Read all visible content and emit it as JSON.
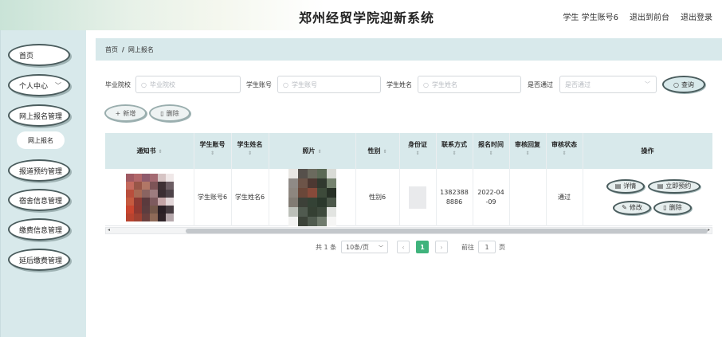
{
  "header": {
    "title": "郑州经贸学院迎新系统",
    "user_role": "学生",
    "user_name": "学生账号6",
    "back_label": "退出到前台",
    "logout_label": "退出登录"
  },
  "sidebar": {
    "items": [
      {
        "label": "首页"
      },
      {
        "label": "个人中心"
      },
      {
        "label": "网上报名管理"
      },
      {
        "label": "网上报名"
      },
      {
        "label": "报道预约管理"
      },
      {
        "label": "宿舍信息管理"
      },
      {
        "label": "缴费信息管理"
      },
      {
        "label": "延后缴费管理"
      }
    ]
  },
  "breadcrumb": {
    "home": "首页",
    "sep": "/",
    "current": "网上报名"
  },
  "search": {
    "school_label": "毕业院校",
    "school_placeholder": "毕业院校",
    "account_label": "学生账号",
    "account_placeholder": "学生账号",
    "name_label": "学生姓名",
    "name_placeholder": "学生姓名",
    "pass_label": "是否通过",
    "pass_placeholder": "是否通过",
    "query_label": "查询"
  },
  "actions": {
    "add_label": "新增",
    "delete_label": "删除"
  },
  "table": {
    "headers": [
      "通知书",
      "学生账号",
      "学生姓名",
      "照片",
      "性别",
      "身份证",
      "联系方式",
      "报名时间",
      "审核回复",
      "审核状态",
      "操作"
    ],
    "row": {
      "account": "学生账号6",
      "name": "学生姓名6",
      "gender": "性别6",
      "phone": "13823888886",
      "time": "2022-04-09",
      "reply": "",
      "status": "通过"
    },
    "ops": {
      "detail": "详情",
      "reserve": "立即预约",
      "edit": "修改",
      "delete": "删除"
    }
  },
  "pagination": {
    "total": "共 1 条",
    "page_size": "10条/页",
    "current_page": "1",
    "goto_label": "前往",
    "goto_value": "1",
    "page_unit": "页"
  },
  "colors": {
    "accent": "#3fb37c",
    "panel": "#d8e9eb",
    "border": "#4a5c5d"
  }
}
